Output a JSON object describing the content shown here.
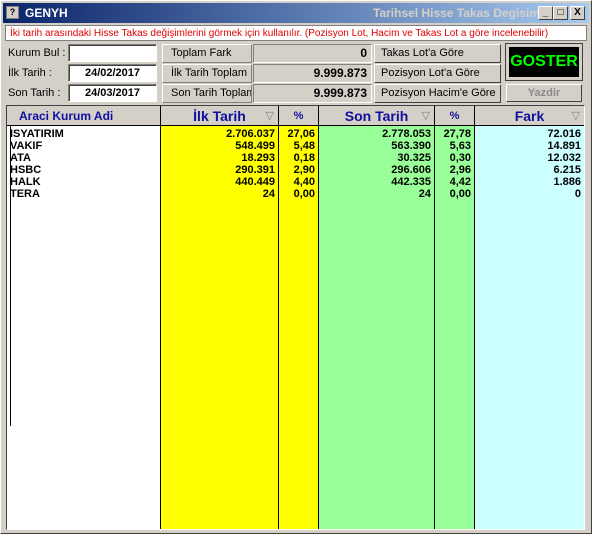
{
  "window": {
    "app_name": "GENYH",
    "caption": "Tarihsel Hisse Takas Degisim",
    "minimize_label": "_",
    "maximize_label": "□",
    "close_label": "X"
  },
  "info_text": "İki tarih arasındaki Hisse Takas değişimlerini görmek için kullanılır. (Pozisyon Lot, Hacim ve Takas Lot a göre incelenebilir)",
  "filters": {
    "kurum_bul_label": "Kurum Bul :",
    "kurum_bul_value": "",
    "ilk_tarih_label": "İlk Tarih    :",
    "ilk_tarih_value": "24/02/2017",
    "son_tarih_label": "Son Tarih   :",
    "son_tarih_value": "24/03/2017"
  },
  "summary": {
    "toplam_fark_label": "Toplam Fark",
    "toplam_fark_value": "0",
    "ilk_tarih_toplam_label": "İlk Tarih Toplam",
    "ilk_tarih_toplam_value": "9.999.873",
    "son_tarih_toplam_label": "Son Tarih Toplam",
    "son_tarih_toplam_value": "9.999.873"
  },
  "options": {
    "takas_lot": "Takas Lot'a Göre",
    "pozisyon_lot": "Pozisyon Lot'a Göre",
    "pozisyon_hacim": "Pozisyon Hacim'e Göre"
  },
  "buttons": {
    "goster": "GOSTER",
    "yazdir": "Yazdir"
  },
  "table": {
    "headers": {
      "name": "Araci Kurum Adi",
      "ilk_tarih": "İlk Tarih",
      "ilk_pct": "%",
      "son_tarih": "Son Tarih",
      "son_pct": "%",
      "fark": "Fark"
    },
    "sort_icon": "▽",
    "rows": [
      {
        "name": "ISYATIRIM",
        "ilk": "2.706.037",
        "ilk_pct": "27,06",
        "son": "2.778.053",
        "son_pct": "27,78",
        "fark": "72.016"
      },
      {
        "name": "VAKIF",
        "ilk": "548.499",
        "ilk_pct": "5,48",
        "son": "563.390",
        "son_pct": "5,63",
        "fark": "14.891"
      },
      {
        "name": "ATA",
        "ilk": "18.293",
        "ilk_pct": "0,18",
        "son": "30.325",
        "son_pct": "0,30",
        "fark": "12.032"
      },
      {
        "name": "HSBC",
        "ilk": "290.391",
        "ilk_pct": "2,90",
        "son": "296.606",
        "son_pct": "2,96",
        "fark": "6.215"
      },
      {
        "name": "HALK",
        "ilk": "440.449",
        "ilk_pct": "4,40",
        "son": "442.335",
        "son_pct": "4,42",
        "fark": "1.886"
      },
      {
        "name": "TERA",
        "ilk": "24",
        "ilk_pct": "0,00",
        "son": "24",
        "son_pct": "0,00",
        "fark": "0"
      }
    ]
  }
}
